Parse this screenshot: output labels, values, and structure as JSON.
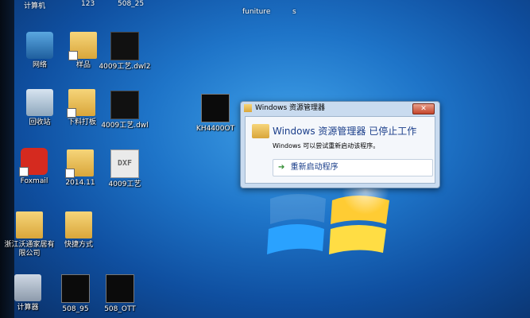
{
  "top_labels": [
    "计算机",
    "123",
    "508_25",
    "funiture",
    "s"
  ],
  "icons": {
    "network": "网络",
    "samples": "样品",
    "file_dwl2": "4009工艺.dwl2",
    "recycle_bin": "回收站",
    "cutting_board": "下料打板",
    "file_dwl": "4009工艺.dwl",
    "foxmail": "Foxmail",
    "folder_2014": "2014.11",
    "file_dxf": "4009工艺",
    "kh4400": "KH4400OT",
    "zhejiang": "浙江沃通家居有限公司",
    "shortcuts": "快捷方式",
    "calculator": "计算器",
    "file_508_95": "508_95",
    "file_508_ott": "508_OTT"
  },
  "dialog": {
    "title": "Windows 资源管理器",
    "close": "✕",
    "heading": "Windows 资源管理器 已停止工作",
    "message": "Windows 可以尝试重新启动该程序。",
    "restart": "重新启动程序"
  },
  "dxf_label": "DXF"
}
